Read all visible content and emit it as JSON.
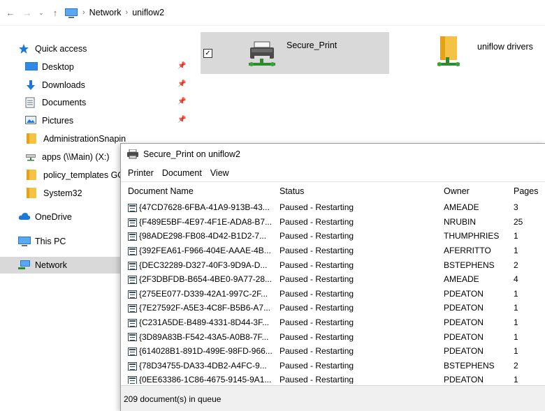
{
  "address_bar": {
    "breadcrumbs": [
      "Network",
      "uniflow2"
    ]
  },
  "nav": {
    "items": [
      {
        "label": "Quick access",
        "icon": "star-icon"
      },
      {
        "label": "Desktop",
        "icon": "desktop-icon",
        "pinned": true
      },
      {
        "label": "Downloads",
        "icon": "download-arrow-icon",
        "pinned": true
      },
      {
        "label": "Documents",
        "icon": "documents-icon",
        "pinned": true
      },
      {
        "label": "Pictures",
        "icon": "pictures-icon",
        "pinned": true
      },
      {
        "label": "AdministrationSnapin",
        "icon": "folder-icon"
      },
      {
        "label": "apps (\\\\Main) (X:)",
        "icon": "network-drive-icon"
      },
      {
        "label": "policy_templates GO",
        "icon": "folder-icon"
      },
      {
        "label": "System32",
        "icon": "folder-icon"
      },
      {
        "label": "OneDrive",
        "icon": "cloud-icon"
      },
      {
        "label": "This PC",
        "icon": "computer-icon"
      },
      {
        "label": "Network",
        "icon": "network-icon",
        "selected": true
      }
    ]
  },
  "content": {
    "tiles": [
      {
        "label": "Secure_Print",
        "selected": true,
        "checked": true,
        "icon": "shared-printer-icon"
      },
      {
        "label": "uniflow drivers",
        "selected": false,
        "icon": "shared-folder-icon"
      }
    ]
  },
  "print_queue": {
    "title": "Secure_Print on uniflow2",
    "menu": [
      "Printer",
      "Document",
      "View"
    ],
    "columns": [
      "Document Name",
      "Status",
      "Owner",
      "Pages"
    ],
    "rows": [
      {
        "name": "{47CD7628-6FBA-41A9-913B-43...",
        "status": "Paused - Restarting",
        "owner": "AMEADE",
        "pages": "3"
      },
      {
        "name": "{F489E5BF-4E97-4F1E-ADA8-B7...",
        "status": "Paused - Restarting",
        "owner": "NRUBIN",
        "pages": "25"
      },
      {
        "name": "{98ADE298-FB08-4D42-B1D2-7...",
        "status": "Paused - Restarting",
        "owner": "THUMPHRIES",
        "pages": "1"
      },
      {
        "name": "{392FEA61-F966-404E-AAAE-4B...",
        "status": "Paused - Restarting",
        "owner": "AFERRITTO",
        "pages": "1"
      },
      {
        "name": "{DEC32289-D327-40F3-9D9A-D...",
        "status": "Paused - Restarting",
        "owner": "BSTEPHENS",
        "pages": "2"
      },
      {
        "name": "{2F3DBFDB-B654-4BE0-9A77-28...",
        "status": "Paused - Restarting",
        "owner": "AMEADE",
        "pages": "4"
      },
      {
        "name": "{275EE077-D339-42A1-997C-2F...",
        "status": "Paused - Restarting",
        "owner": "PDEATON",
        "pages": "1"
      },
      {
        "name": "{7E27592F-A5E3-4C8F-B5B6-A7...",
        "status": "Paused - Restarting",
        "owner": "PDEATON",
        "pages": "1"
      },
      {
        "name": "{C231A5DE-B489-4331-8D44-3F...",
        "status": "Paused - Restarting",
        "owner": "PDEATON",
        "pages": "1"
      },
      {
        "name": "{3D89A83B-F542-43A5-A0B8-7F...",
        "status": "Paused - Restarting",
        "owner": "PDEATON",
        "pages": "1"
      },
      {
        "name": "{614028B1-891D-499E-98FD-966...",
        "status": "Paused - Restarting",
        "owner": "PDEATON",
        "pages": "1"
      },
      {
        "name": "{78D34755-DA33-4DB2-A4FC-9...",
        "status": "Paused - Restarting",
        "owner": "BSTEPHENS",
        "pages": "2"
      },
      {
        "name": "{0EE63386-1C86-4675-9145-9A1...",
        "status": "Paused - Restarting",
        "owner": "PDEATON",
        "pages": "1"
      }
    ],
    "status_bar": "209 document(s) in queue"
  },
  "colors": {
    "selection": "#d9d9d9",
    "folder": "#f5c343",
    "accent_blue": "#1e78d7"
  }
}
